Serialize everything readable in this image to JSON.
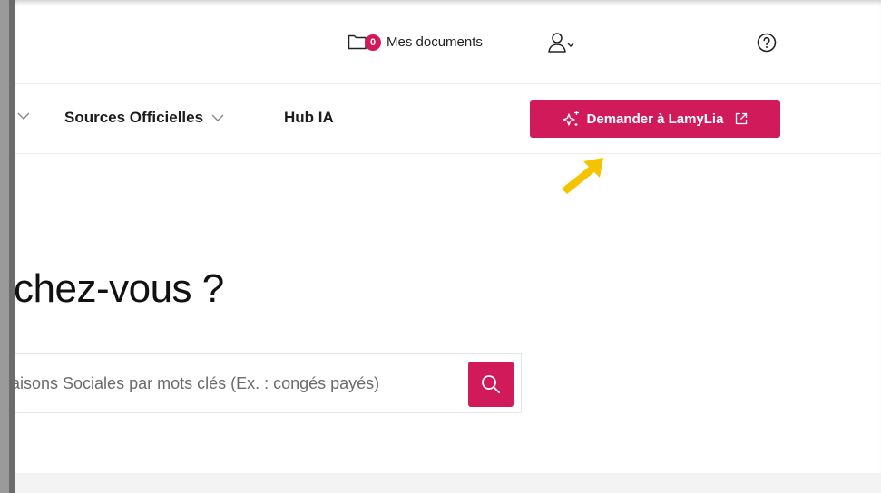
{
  "header": {
    "docs_count": "0",
    "docs_label": "Mes documents",
    "icons": {
      "folder": "folder-icon",
      "user": "user-icon",
      "help": "help-icon"
    }
  },
  "nav": {
    "items": [
      {
        "label": "Sources Officielles",
        "has_chevron": true
      },
      {
        "label": "Hub IA",
        "has_chevron": false
      }
    ],
    "cta_label": "Demander à LamyLia",
    "accent": "#d01a59"
  },
  "main": {
    "heading": "chez-vous ?",
    "search_placeholder": "aisons Sociales par mots clés (Ex. : congés payés)"
  }
}
